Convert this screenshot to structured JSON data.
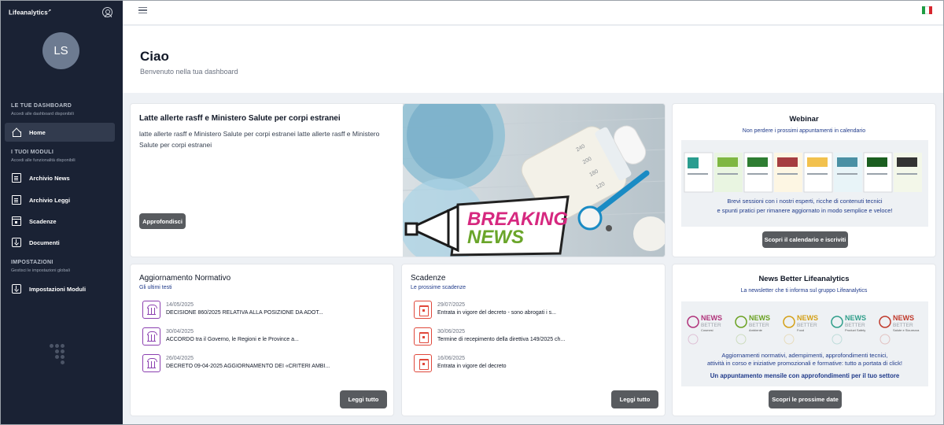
{
  "sidebar": {
    "brand": "Lifeanalytics",
    "avatar_initials": "LS",
    "sections": [
      {
        "title": "LE TUE DASHBOARD",
        "subtitle": "Accedi alle dashboard disponibili"
      },
      {
        "title": "I TUOI MODULI",
        "subtitle": "Accedi alle funzionalità disponibili"
      },
      {
        "title": "IMPOSTAZIONI",
        "subtitle": "Gestisci le impostazioni globali"
      }
    ],
    "items": [
      {
        "label": "Home",
        "icon": "home-icon",
        "active": true
      },
      {
        "label": "Archivio News",
        "icon": "news-archive-icon"
      },
      {
        "label": "Archivio Leggi",
        "icon": "law-archive-icon"
      },
      {
        "label": "Scadenze",
        "icon": "calendar-icon"
      },
      {
        "label": "Documenti",
        "icon": "documents-icon"
      },
      {
        "label": "Impostazioni Moduli",
        "icon": "modules-settings-icon"
      }
    ]
  },
  "header": {
    "title": "Ciao",
    "subtitle": "Benvenuto nella tua dashboard",
    "language_flag": "italy-flag"
  },
  "news": {
    "title": "Latte allerte rasff e Ministero Salute per corpi estranei",
    "text": "latte allerte rasff e Ministero Salute per corpi estranei latte allerte rasff e Ministero Salute per corpi estranei",
    "button": "Approfondisci",
    "hero_line1": "BREAKING",
    "hero_line2": "NEWS",
    "bottle_marks": [
      "240",
      "200",
      "180",
      "120"
    ]
  },
  "webinar": {
    "title": "Webinar",
    "subtitle": "Non perdere i prossimi appuntamenti in calendario",
    "description_line1": "Brevi sessioni con i nostri esperti, ricche di contenuti tecnici",
    "description_line2": "e spunti pratici per rimanere aggiornato in modo semplice e veloce!",
    "button": "Scopri il calendario e iscriviti"
  },
  "normativo": {
    "title": "Aggiornamento Normativo",
    "subtitle": "Gli ultimi testi",
    "items": [
      {
        "date": "14/05/2025",
        "text": "DECISIONE 860/2025 RELATIVA ALLA POSIZIONE DA ADOT..."
      },
      {
        "date": "30/04/2025",
        "text": "ACCORDO tra il Governo, le Regioni e le Province a..."
      },
      {
        "date": "26/04/2025",
        "text": "DECRETO 09-04-2025 AGGIORNAMENTO DEI «CRITERI AMBI..."
      }
    ],
    "button": "Leggi tutto"
  },
  "scadenze": {
    "title": "Scadenze",
    "subtitle": "Le prossime scadenze",
    "items": [
      {
        "date": "29/07/2025",
        "text": "Entrata in vigore del decreto - sono abrogati i s..."
      },
      {
        "date": "30/06/2025",
        "text": "Termine di recepimento della direttiva 149/2025 ch..."
      },
      {
        "date": "16/06/2025",
        "text": "Entrata in vigore del decreto"
      }
    ],
    "button": "Leggi tutto"
  },
  "newsletter": {
    "title": "News Better Lifeanalytics",
    "subtitle": "La newsletter che ti informa sul gruppo Lifeanalytics",
    "logos": [
      {
        "name": "Cosmesi",
        "color": "#b0327a"
      },
      {
        "name": "Ambiente",
        "color": "#6aa121"
      },
      {
        "name": "Food",
        "color": "#d4a017"
      },
      {
        "name": "Product Safety",
        "color": "#2f9e8a"
      },
      {
        "name": "Salute e Sicurezza",
        "color": "#c0392b"
      }
    ],
    "logo_word1": "NEWS",
    "logo_word2": "BETTER",
    "text_line1": "Aggiornamenti normativi, adempimenti, approfondimenti tecnici,",
    "text_line2": "attività in corso e iniziative promozionali e formative: tutto a portata di click!",
    "text_bold": "Un appuntamento mensile con approfondimenti per il tuo settore",
    "button": "Scopri le prossime date"
  }
}
